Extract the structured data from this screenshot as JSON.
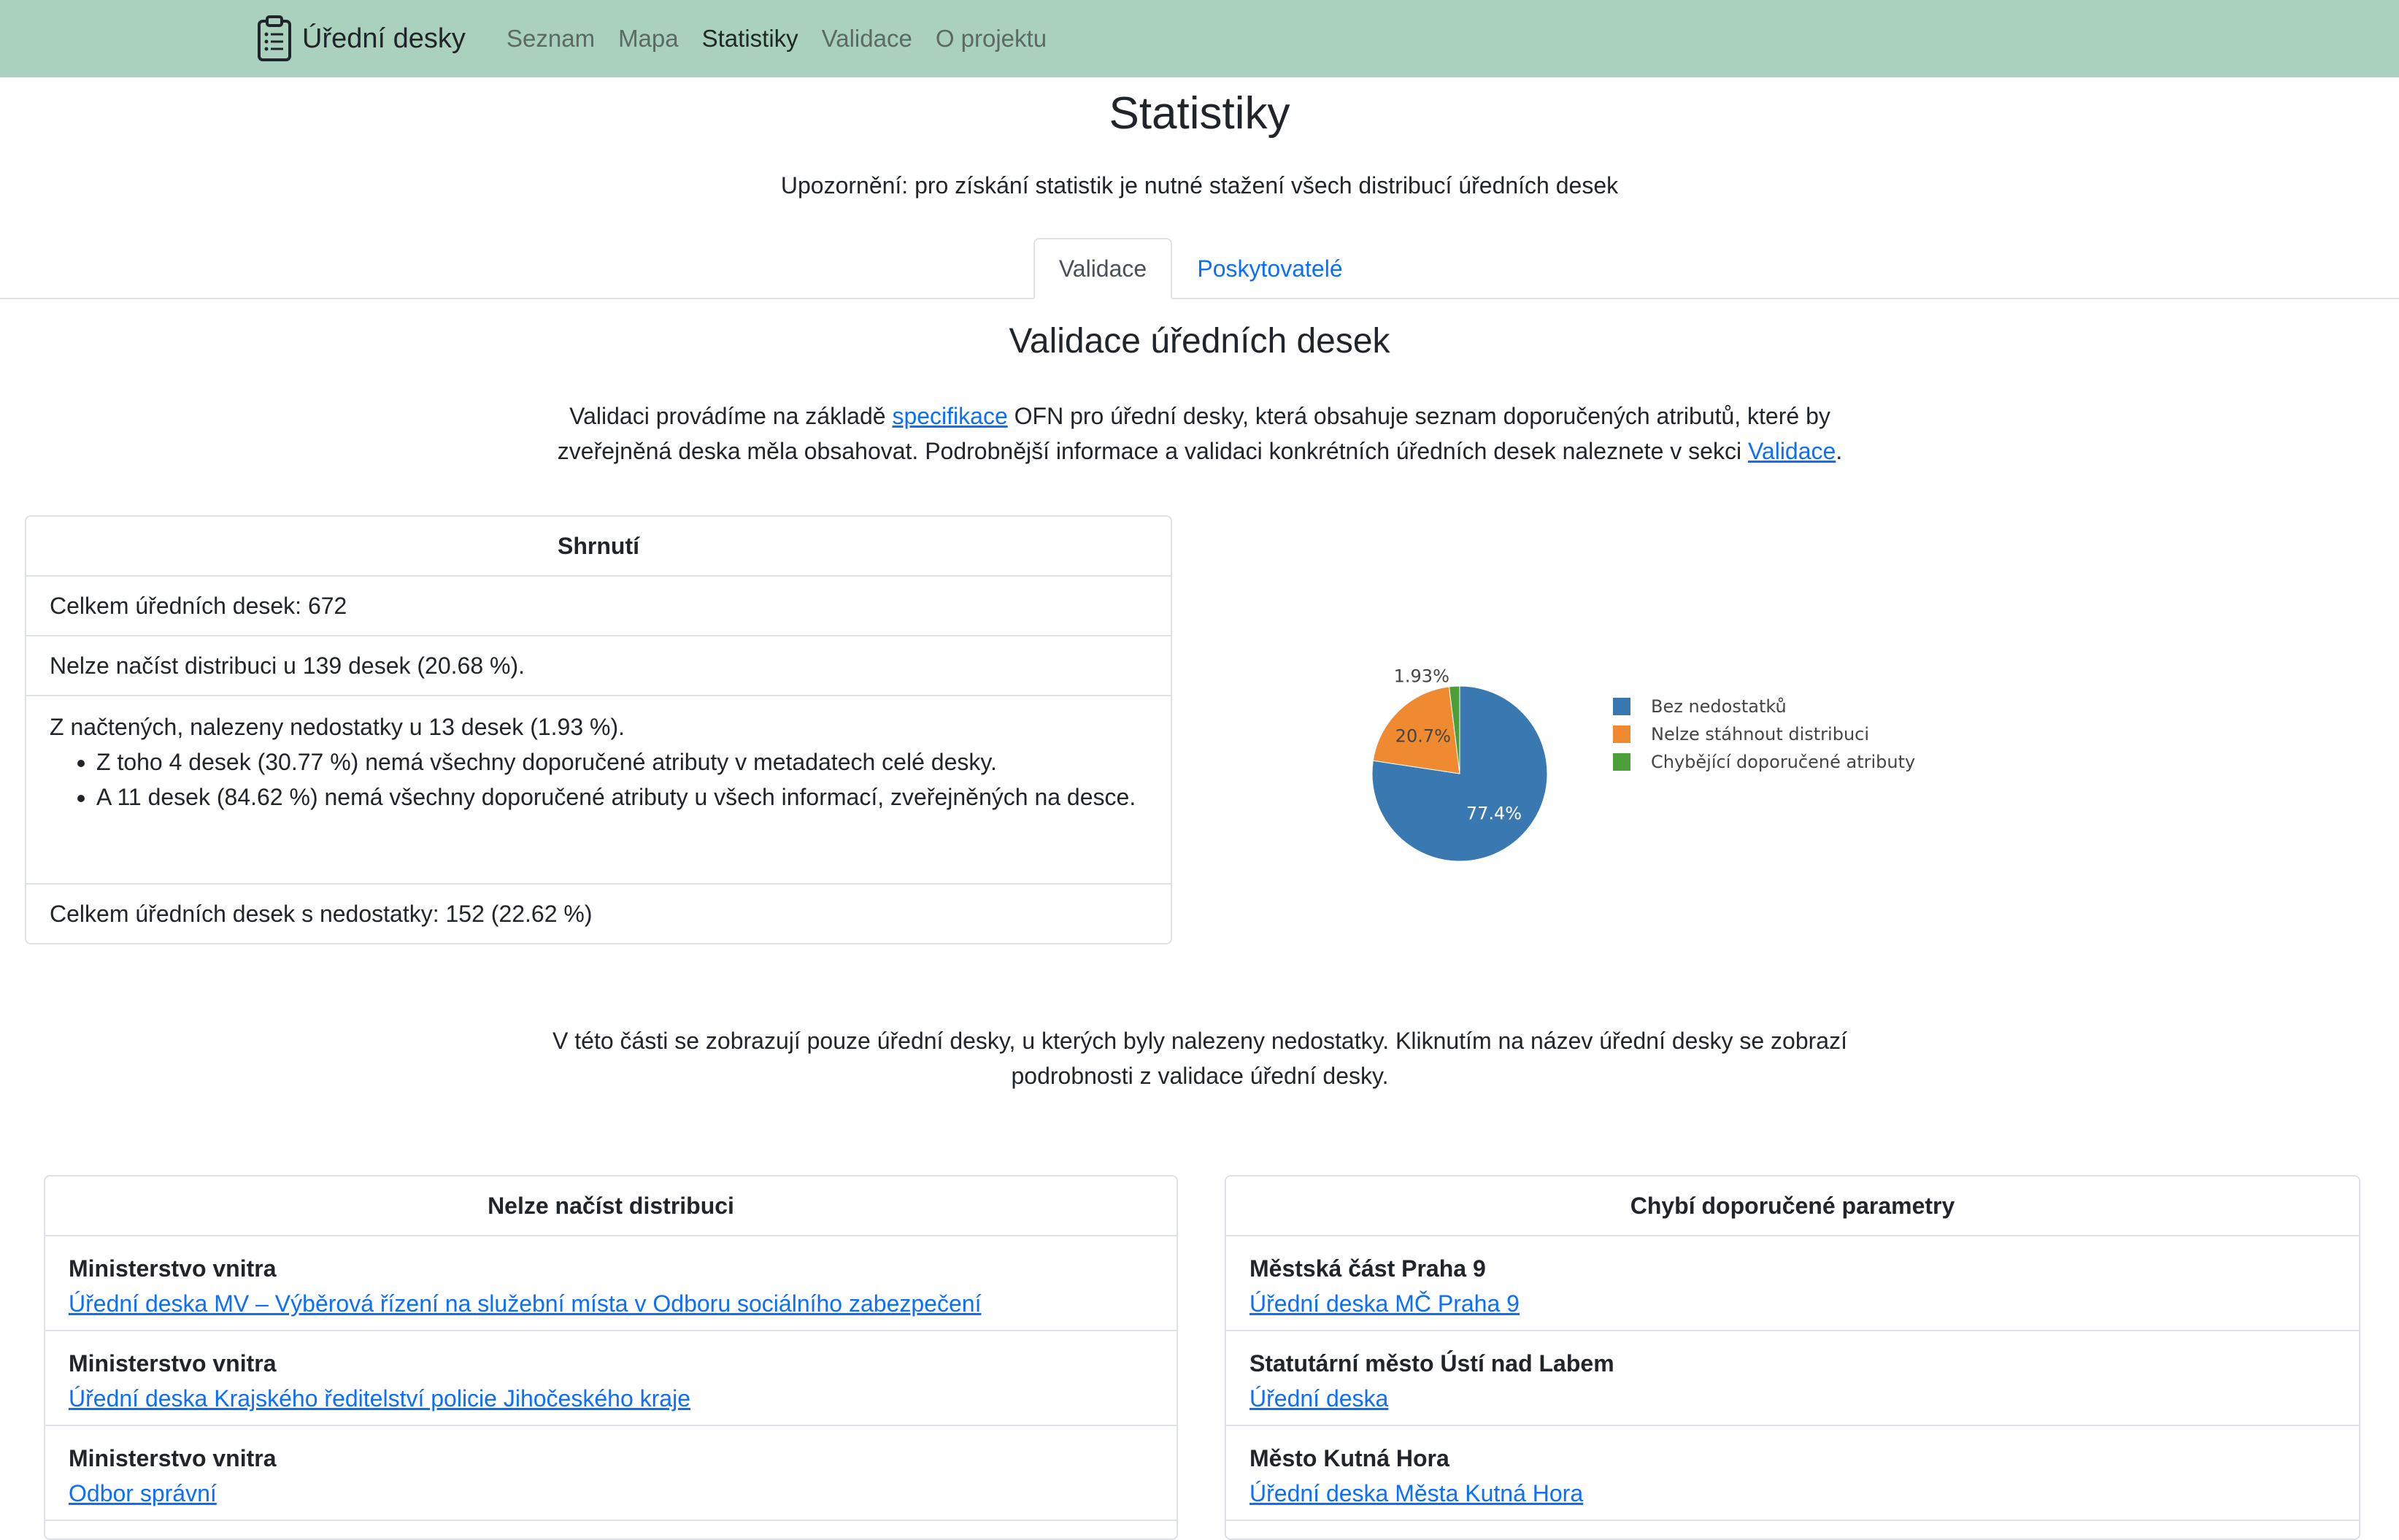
{
  "navbar": {
    "brand": "Úřední desky",
    "links": [
      {
        "label": "Seznam",
        "active": false
      },
      {
        "label": "Mapa",
        "active": false
      },
      {
        "label": "Statistiky",
        "active": true
      },
      {
        "label": "Validace",
        "active": false
      },
      {
        "label": "O projektu",
        "active": false
      }
    ]
  },
  "header": {
    "title": "Statistiky",
    "notice": "Upozornění: pro získání statistik je nutné stažení všech distribucí úředních desek"
  },
  "tabs": [
    {
      "label": "Validace",
      "active": true
    },
    {
      "label": "Poskytovatelé",
      "active": false
    }
  ],
  "validation": {
    "title": "Validace úředních desek",
    "intro_before": "Validaci provádíme na základě ",
    "intro_link1": "specifikace",
    "intro_middle": " OFN pro úřední desky, která obsahuje seznam doporučených atributů, které by zveřejněná deska měla obsahovat. Podrobnější informace a validaci konkrétních úředních desek naleznete v sekci ",
    "intro_link2": "Validace",
    "intro_after": "."
  },
  "summary": {
    "header": "Shrnutí",
    "total": "Celkem úředních desek: 672",
    "cannot_load": "Nelze načíst distribuci u 139 desek (20.68 %).",
    "loaded_issues": "Z načtených, nalezeny nedostatky u 13 desek (1.93 %).",
    "bullets": [
      "Z toho 4 desek (30.77 %) nemá všechny doporučené atributy v metadatech celé desky.",
      "A 11 desek (84.62 %) nemá všechny doporučené atributy u všech informací, zveřejněných na desce."
    ],
    "total_issues": "Celkem úředních desek s nedostatky: 152 (22.62 %)"
  },
  "chart_data": {
    "type": "pie",
    "series": [
      {
        "name": "Bez nedostatků",
        "value": 77.4,
        "label": "77.4%",
        "color": "#3a78b1"
      },
      {
        "name": "Nelze stáhnout distribuci",
        "value": 20.7,
        "label": "20.7%",
        "color": "#ef8a31"
      },
      {
        "name": "Chybějící doporučené atributy",
        "value": 1.93,
        "label": "1.93%",
        "color": "#4c9f38"
      }
    ],
    "legend": "right"
  },
  "middle_text": "V této části se zobrazují pouze úřední desky, u kterých byly nalezeny nedostatky. Kliknutím na název úřední desky se zobrazí podrobnosti z validace úřední desky.",
  "lists": {
    "left": {
      "header": "Nelze načíst distribuci",
      "items": [
        {
          "org": "Ministerstvo vnitra",
          "link": "Úřední deska MV – Výběrová řízení na služební místa v Odboru sociálního zabezpečení"
        },
        {
          "org": "Ministerstvo vnitra",
          "link": "Úřední deska Krajského ředitelství policie Jihočeského kraje"
        },
        {
          "org": "Ministerstvo vnitra",
          "link": "Odbor správní"
        }
      ]
    },
    "right": {
      "header": "Chybí doporučené parametry",
      "items": [
        {
          "org": "Městská část Praha 9",
          "link": "Úřední deska MČ Praha 9"
        },
        {
          "org": "Statutární město Ústí nad Labem",
          "link": "Úřední deska"
        },
        {
          "org": "Město Kutná Hora",
          "link": "Úřední deska Města Kutná Hora"
        }
      ]
    }
  }
}
